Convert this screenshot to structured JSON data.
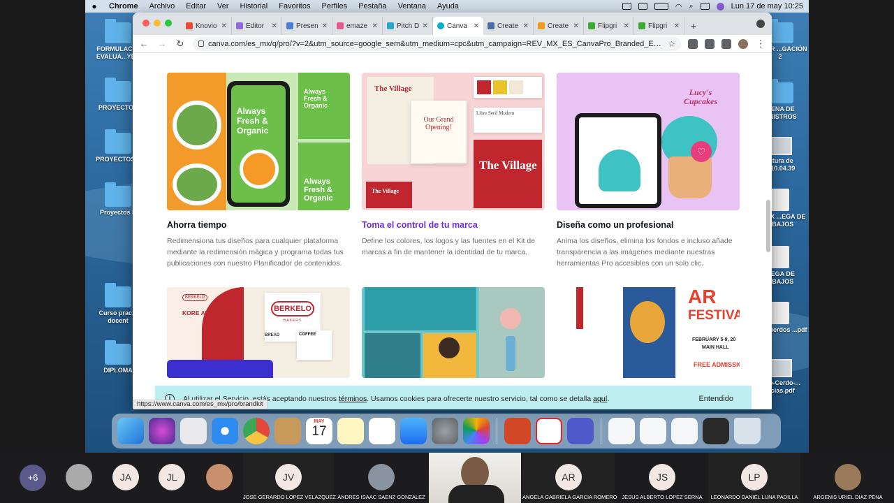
{
  "menubar": {
    "items": [
      "Chrome",
      "Archivo",
      "Editar",
      "Ver",
      "Historial",
      "Favoritos",
      "Perfiles",
      "Pestaña",
      "Ventana",
      "Ayuda"
    ],
    "clock": "Lun 17 de may  10:25"
  },
  "desktop": {
    "left_icons": [
      "FORMULACI... EVALUA...YEC",
      "PROYECTOS",
      "PROYECTOS 2",
      "Proyectos E",
      "Curso prac... docent",
      "DIPLOMA"
    ],
    "right_icons": [
      "...LLER ...GACIÓN 2",
      "...ENA DE ...NISTROS",
      "...tura de ...10.04.39",
      ".DOCX ...EGA DE ...BAJOS",
      "...EGA DE ...BAJOS",
      "...oacuerdos ...pdf",
      "...ño-Cerdo-... ...cias.pdf"
    ]
  },
  "browser": {
    "tabs": [
      {
        "label": "Knovio",
        "color": "#e84a3a"
      },
      {
        "label": "Editor",
        "color": "#8e6bd8"
      },
      {
        "label": "Presen",
        "color": "#4a7fd8"
      },
      {
        "label": "emaze",
        "color": "#e25b8a"
      },
      {
        "label": "Pitch D",
        "color": "#2aa6c9"
      },
      {
        "label": "Canva",
        "color": "#00b0c8"
      },
      {
        "label": "Create",
        "color": "#4a6fa5"
      },
      {
        "label": "Create",
        "color": "#f29b1f"
      },
      {
        "label": "Flipgri",
        "color": "#3aaa35"
      },
      {
        "label": "Flipgri",
        "color": "#3aaa35"
      }
    ],
    "active_tab": "Canva",
    "url": "canva.com/es_mx/q/pro/?v=2&utm_source=google_sem&utm_medium=cpc&utm_campaign=REV_MX_ES_CanvaPro_Branded_EM&utm...",
    "status_url": "https://www.canva.com/es_mx/pro/brandkit"
  },
  "page": {
    "features": [
      {
        "title": "Ahorra tiempo",
        "description": "Redimensiona tus diseños para cualquier plataforma mediante la redimensión mágica y programa todas tus publicaciones con nuestro Planificador de contenidos.",
        "thumb_texts": [
          "Always Fresh & Organic",
          "Always Fresh & Organic",
          "Always Fresh & Organic"
        ]
      },
      {
        "title": "Toma el control de tu marca",
        "description": "Define los colores, los logos y las fuentes en el Kit de marcas a fin de mantener la identidad de tu marca.",
        "thumb_texts": [
          "The Village",
          "Our Grand Opening!",
          "Libre Serif Modern",
          "The Village",
          "The Village"
        ]
      },
      {
        "title": "Diseña como un profesional",
        "description": "Anima los diseños, elimina los fondos e incluso añade transparencia a las imágenes mediante nuestras herramientas Pro accesibles con un solo clic.",
        "thumb_texts": [
          "Lucy's Cupcakes"
        ]
      }
    ],
    "second_row": {
      "card1_texts": [
        "BERKELO",
        "KORE ATHLETICA",
        "BERKELO",
        "BAKERY",
        "BREAD",
        "COFFEE"
      ],
      "card3_texts": [
        "AR",
        "FESTIVA",
        "FEBRUARY 5-9, 20",
        "MAIN HALL",
        "FREE ADMISSIO"
      ]
    },
    "cookie": {
      "text_before": "Al utilizar el Servicio, estás aceptando nuestros ",
      "link1": "términos",
      "text_middle": ". Usamos cookies para ofrecerte nuestro servicio, tal como se detalla ",
      "link2": "aquí",
      "text_end": ".",
      "button": "Entendido"
    }
  },
  "dock": {
    "calendar_month": "MAY",
    "calendar_day": "17"
  },
  "participants": {
    "more": "+6",
    "tiles": [
      {
        "initials": "",
        "name": ""
      },
      {
        "initials": "JA",
        "name": ""
      },
      {
        "initials": "JL",
        "name": ""
      },
      {
        "initials": "",
        "name": ""
      },
      {
        "initials": "JV",
        "name": "JOSE GERARDO LOPEZ VELAZQUEZ"
      },
      {
        "initials": "",
        "name": "ANDRES ISAAC SAENZ GONZALEZ"
      },
      {
        "initials": "AR",
        "name": "ANGELA GABRIELA GARCIA ROMERO"
      },
      {
        "initials": "JS",
        "name": "JESUS ALBERTO LOPEZ SERNA"
      },
      {
        "initials": "LP",
        "name": "LEONARDO DANIEL LUNA PADILLA"
      },
      {
        "initials": "",
        "name": "ARGENIS URIEL DIAZ PENA"
      }
    ]
  }
}
